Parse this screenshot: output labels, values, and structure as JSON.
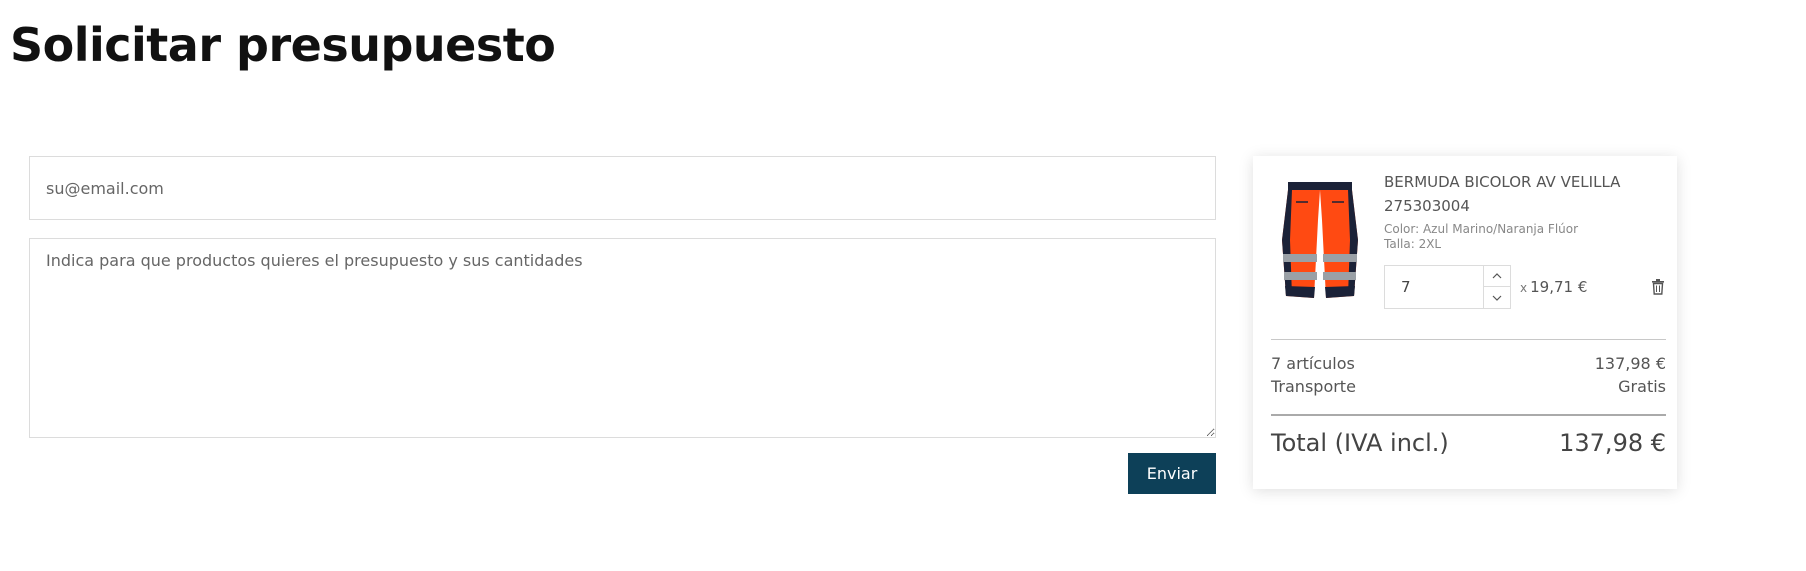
{
  "page": {
    "title": "Solicitar presupuesto"
  },
  "form": {
    "email_placeholder": "su@email.com",
    "message_placeholder": "Indica para que productos quieres el presupuesto y sus cantidades",
    "send_label": "Enviar"
  },
  "cart": {
    "item": {
      "name": "BERMUDA BICOLOR AV VELILLA",
      "reference": "275303004",
      "color": "Color: Azul Marino/Naranja Flúor",
      "size": "Talla: 2XL",
      "quantity": "7",
      "times": "x",
      "unit_price": "19,71 €",
      "image_icon": "shorts-product-image"
    },
    "summary": {
      "articles_label": "7 artículos",
      "articles_value": "137,98 €",
      "shipping_label": "Transporte",
      "shipping_value": "Gratis",
      "total_label": "Total (IVA incl.)",
      "total_value": "137,98 €"
    }
  },
  "colors": {
    "button_bg": "#0d4058",
    "product_orange": "#ff4a12",
    "product_navy": "#1b2238",
    "reflective_grey": "#9aa0a6"
  }
}
